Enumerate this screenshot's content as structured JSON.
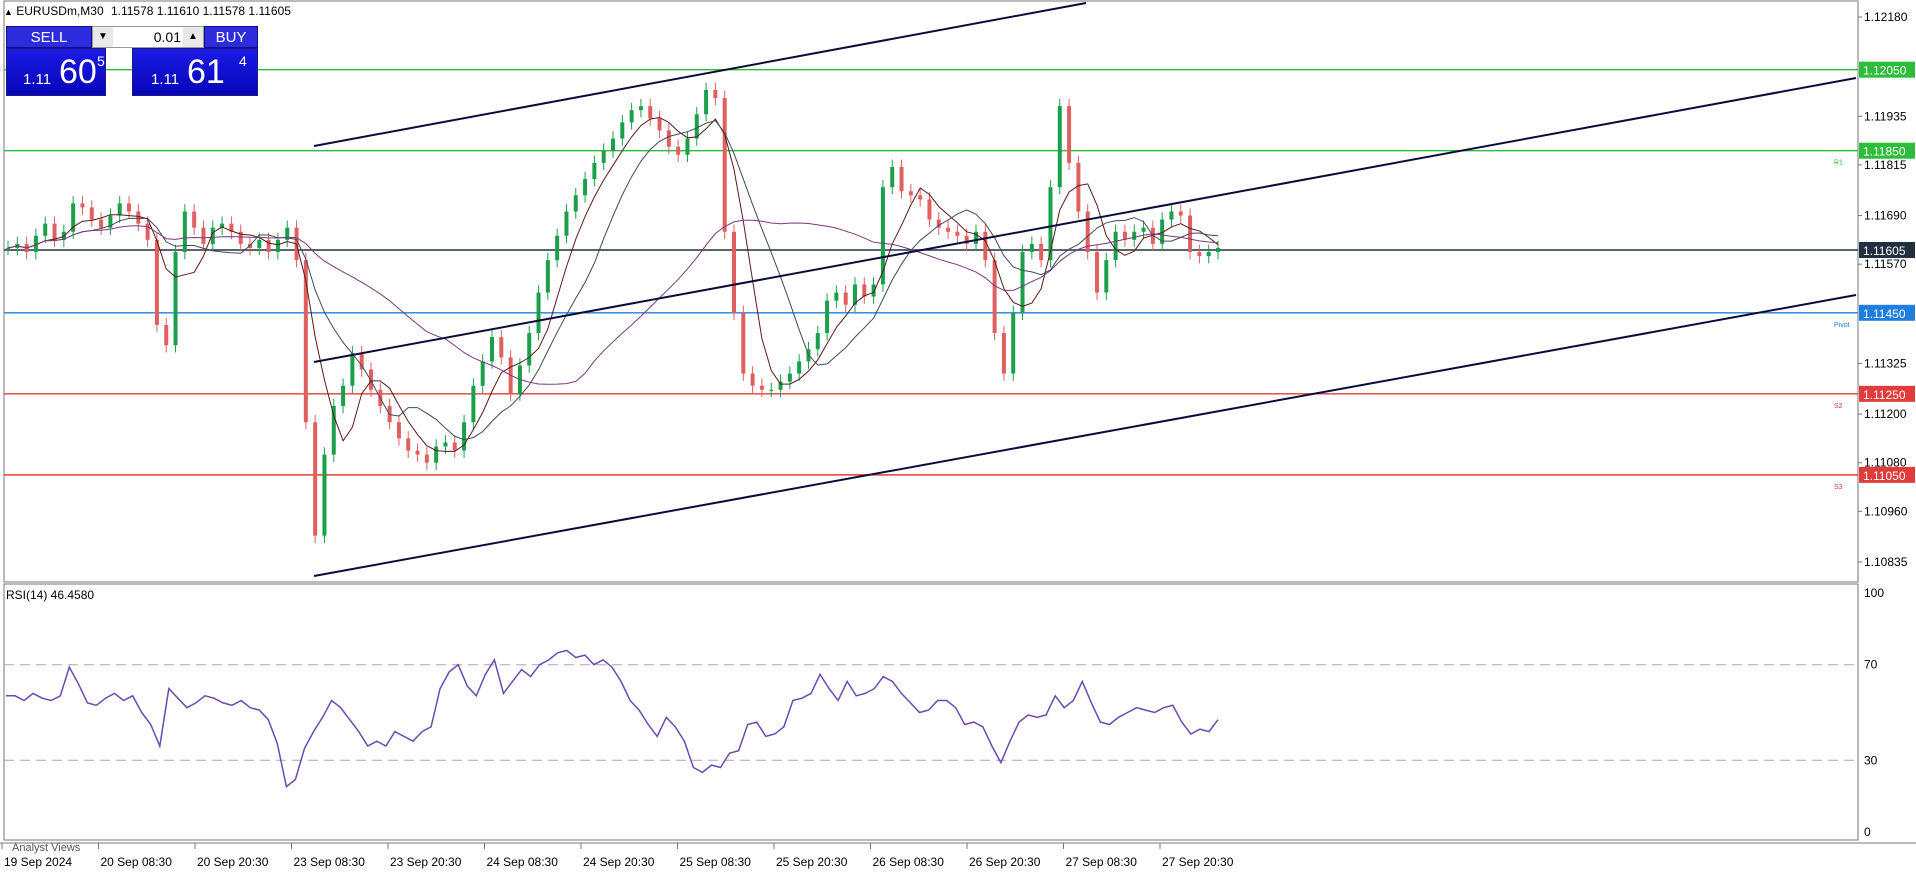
{
  "symbol_header": {
    "title": "EURUSDm,M30",
    "ohlc": "1.11578 1.11610 1.11578 1.11605"
  },
  "trade_panel": {
    "sell_label": "SELL",
    "buy_label": "BUY",
    "lot": "0.01",
    "bid_prefix": "1.11",
    "bid_big": "60",
    "bid_sup": "5",
    "ask_prefix": "1.11",
    "ask_big": "61",
    "ask_sup": "4"
  },
  "price_scale": [
    "1.12180",
    "1.11935",
    "1.11815",
    "1.11690",
    "1.11570",
    "1.11325",
    "1.11200",
    "1.11080",
    "1.10960",
    "1.10835"
  ],
  "levels": [
    {
      "price": "1.12050",
      "color": "#2dbd3a",
      "tag": ""
    },
    {
      "price": "1.11850",
      "color": "#2dbd3a",
      "tag": "R1"
    },
    {
      "price": "1.11605",
      "color": "#203040",
      "tag": ""
    },
    {
      "price": "1.11450",
      "color": "#1f7fe0",
      "tag": "Pivot"
    },
    {
      "price": "1.11250",
      "color": "#e23b3b",
      "tag": "S2"
    },
    {
      "price": "1.11050",
      "color": "#e23b3b",
      "tag": "S3"
    }
  ],
  "rsi": {
    "label": "RSI(14) 46.4580",
    "scale": [
      "100",
      "70",
      "30",
      "0"
    ],
    "values": [
      57,
      57,
      55,
      58,
      56,
      55,
      57,
      69,
      62,
      54,
      53,
      56,
      58,
      55,
      57,
      50,
      45,
      36,
      60,
      56,
      52,
      54,
      57,
      56,
      54,
      53,
      55,
      52,
      51,
      47,
      37,
      19,
      22,
      35,
      42,
      48,
      55,
      52,
      47,
      42,
      36,
      38,
      36,
      42,
      40,
      38,
      42,
      44,
      60,
      67,
      70,
      61,
      57,
      66,
      72,
      58,
      63,
      68,
      65,
      70,
      72,
      75,
      76,
      73,
      74,
      70,
      72,
      69,
      63,
      55,
      51,
      45,
      40,
      48,
      44,
      38,
      27,
      25,
      28,
      27,
      33,
      34,
      45,
      46,
      40,
      41,
      44,
      55,
      56,
      58,
      66,
      60,
      55,
      63,
      57,
      58,
      60,
      65,
      63,
      58,
      54,
      50,
      51,
      55,
      55,
      52,
      45,
      46,
      44,
      36,
      29,
      38,
      46,
      49,
      48,
      49,
      57,
      52,
      55,
      63,
      54,
      46,
      45,
      48,
      50,
      52,
      51,
      50,
      52,
      53,
      46,
      41,
      43,
      42,
      47
    ],
    "color": "#6a4bb0"
  },
  "time_axis": [
    "19 Sep 2024",
    "20 Sep 08:30",
    "20 Sep 20:30",
    "23 Sep 08:30",
    "23 Sep 20:30",
    "24 Sep 08:30",
    "24 Sep 20:30",
    "25 Sep 08:30",
    "25 Sep 20:30",
    "26 Sep 08:30",
    "26 Sep 20:30",
    "27 Sep 08:30",
    "27 Sep 20:30"
  ],
  "bottom_tab": "Analyst Views",
  "colors": {
    "bull": "#1aa04a",
    "bear": "#e06060",
    "channel": "#0b0b3a",
    "ma_dark": "#5a1a1a",
    "ma_gray": "#404a5a",
    "ma_purple": "#7a3a7a"
  },
  "candles_close": [
    1.1161,
    1.1162,
    1.116,
    1.1164,
    1.1167,
    1.1163,
    1.1165,
    1.1172,
    1.1171,
    1.1168,
    1.1166,
    1.1169,
    1.1172,
    1.117,
    1.1167,
    1.1163,
    1.1142,
    1.1137,
    1.116,
    1.117,
    1.1166,
    1.1162,
    1.1166,
    1.1167,
    1.1165,
    1.1162,
    1.1161,
    1.1163,
    1.116,
    1.1163,
    1.1166,
    1.1158,
    1.1118,
    1.109,
    1.111,
    1.1122,
    1.1127,
    1.1135,
    1.1131,
    1.1126,
    1.1122,
    1.1118,
    1.1114,
    1.1111,
    1.111,
    1.1108,
    1.1112,
    1.1113,
    1.1111,
    1.1118,
    1.1127,
    1.1133,
    1.1139,
    1.1134,
    1.1125,
    1.1132,
    1.114,
    1.115,
    1.1158,
    1.1164,
    1.117,
    1.1174,
    1.1178,
    1.1182,
    1.1185,
    1.1188,
    1.1192,
    1.1195,
    1.1196,
    1.1193,
    1.119,
    1.1186,
    1.1184,
    1.1188,
    1.1194,
    1.12,
    1.1198,
    1.1165,
    1.1145,
    1.113,
    1.1127,
    1.1126,
    1.1126,
    1.1128,
    1.113,
    1.1133,
    1.1136,
    1.114,
    1.1148,
    1.115,
    1.1147,
    1.1152,
    1.1149,
    1.1152,
    1.1176,
    1.1181,
    1.1175,
    1.1174,
    1.1173,
    1.1168,
    1.1166,
    1.1165,
    1.1164,
    1.1162,
    1.1165,
    1.1158,
    1.114,
    1.113,
    1.1145,
    1.116,
    1.1162,
    1.1158,
    1.1176,
    1.1196,
    1.1182,
    1.117,
    1.116,
    1.115,
    1.1158,
    1.1165,
    1.1163,
    1.1165,
    1.1166,
    1.1162,
    1.1168,
    1.117,
    1.1169,
    1.116,
    1.1159,
    1.116,
    1.1161
  ]
}
